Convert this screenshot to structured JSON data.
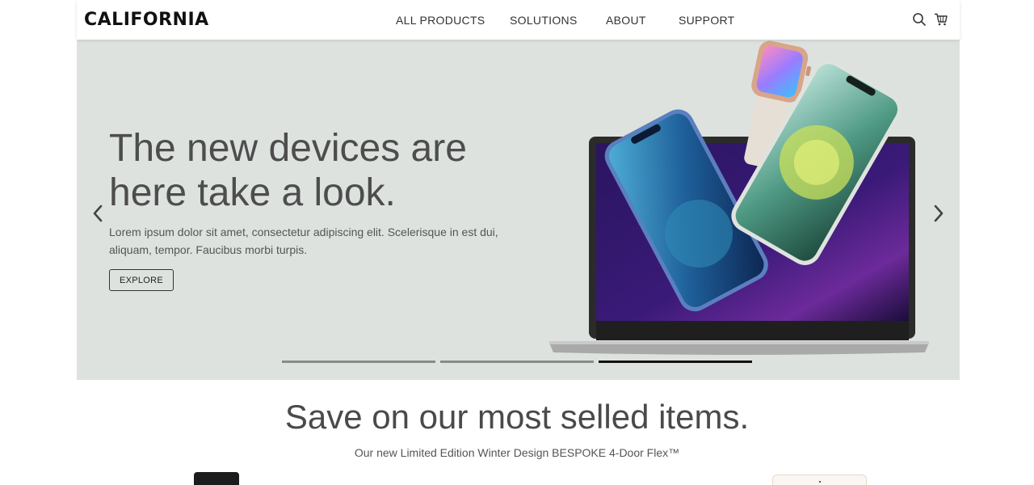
{
  "header": {
    "logo": "CALIFORNIA",
    "nav": [
      "ALL PRODUCTS",
      "SOLUTIONS",
      "ABOUT",
      "SUPPORT"
    ],
    "icons": [
      "search-icon",
      "cart-icon"
    ]
  },
  "hero": {
    "title": "The new devices are here take a look.",
    "text": "Lorem ipsum dolor sit amet, consectetur adipiscing elit. Scelerisque in est dui, aliquam, tempor. Faucibus morbi turpis.",
    "button_label": "EXPLORE",
    "slides": 3,
    "active_slide": 3,
    "background_color": "#dde2df"
  },
  "section": {
    "title": "Save on our most selled items.",
    "subtitle": "Our new Limited Edition Winter Design BESPOKE 4-Door Flex™"
  }
}
